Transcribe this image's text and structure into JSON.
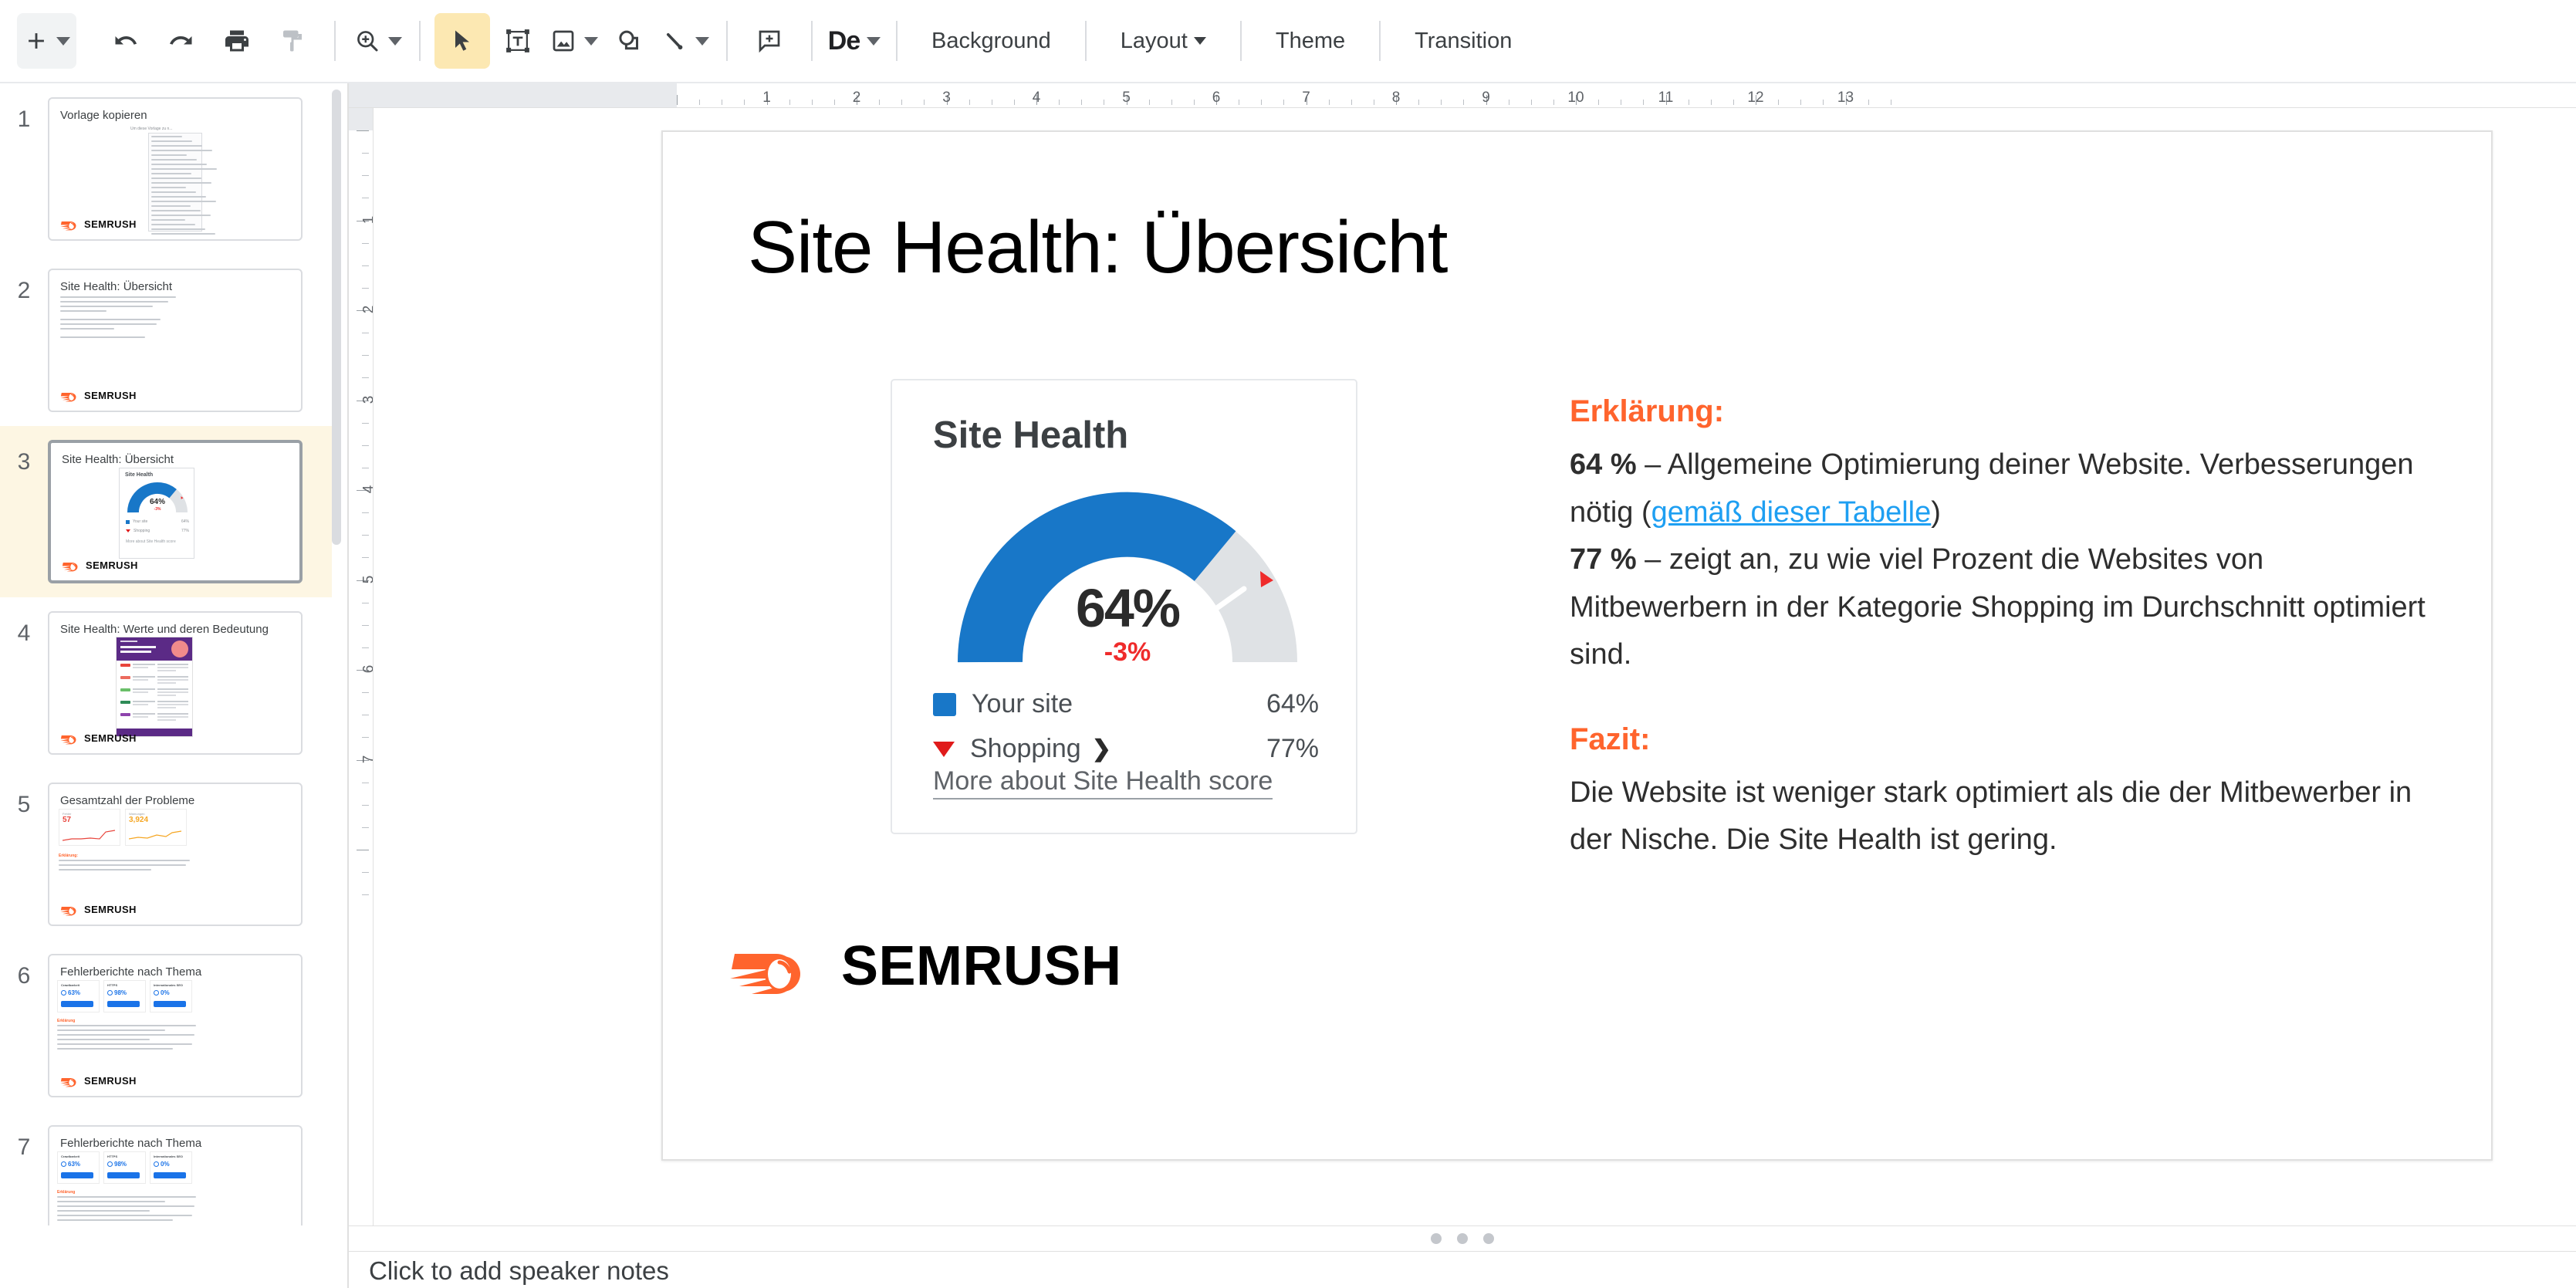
{
  "toolbar": {
    "new_slide_label": "+",
    "buttons": [
      {
        "name": "new-slide",
        "icon": "plus-icon"
      },
      {
        "name": "undo",
        "icon": "undo-arrow-icon"
      },
      {
        "name": "redo",
        "icon": "redo-arrow-icon"
      },
      {
        "name": "print",
        "icon": "printer-icon"
      },
      {
        "name": "paint-format",
        "icon": "paint-roller-icon"
      },
      {
        "name": "zoom",
        "icon": "magnifier-plus-icon"
      },
      {
        "name": "select",
        "icon": "cursor-arrow-icon"
      },
      {
        "name": "text-box",
        "icon": "text-box-icon"
      },
      {
        "name": "insert-image",
        "icon": "image-icon"
      },
      {
        "name": "shape",
        "icon": "shape-icon"
      },
      {
        "name": "line",
        "icon": "line-icon"
      },
      {
        "name": "comment",
        "icon": "comment-plus-icon"
      }
    ],
    "font_label": "De",
    "background_label": "Background",
    "layout_label": "Layout",
    "theme_label": "Theme",
    "transition_label": "Transition"
  },
  "slide_panel": {
    "slides": [
      {
        "number": "1",
        "title": "Vorlage kopieren",
        "logo": "SEMRUSH",
        "selected": false,
        "kind": "doc"
      },
      {
        "number": "2",
        "title": "Site Health: Übersicht",
        "logo": "SEMRUSH",
        "selected": false,
        "kind": "text"
      },
      {
        "number": "3",
        "title": "Site Health: Übersicht",
        "logo": "SEMRUSH",
        "selected": true,
        "kind": "gauge"
      },
      {
        "number": "4",
        "title": "Site Health: Werte und deren Bedeutung",
        "logo": "SEMRUSH",
        "selected": false,
        "kind": "table"
      },
      {
        "number": "5",
        "title": "Gesamtzahl der Probleme",
        "logo": "SEMRUSH",
        "selected": false,
        "kind": "charts"
      },
      {
        "number": "6",
        "title": "Fehlerberichte nach Thema",
        "logo": "SEMRUSH",
        "selected": false,
        "kind": "cards"
      },
      {
        "number": "7",
        "title": "Fehlerberichte nach Thema",
        "logo": "SEMRUSH",
        "selected": false,
        "kind": "cards"
      }
    ]
  },
  "ruler": {
    "horizontal_labels": [
      "1",
      "2",
      "3",
      "4",
      "5",
      "6",
      "7",
      "8",
      "9",
      "10",
      "11",
      "12",
      "13"
    ],
    "vertical_labels": [
      "1",
      "2",
      "3",
      "4",
      "5",
      "6",
      "7"
    ]
  },
  "slide": {
    "title": "Site Health: Übersicht",
    "logo_text": "SEMRUSH",
    "widget": {
      "heading": "Site Health",
      "gauge_value": "64%",
      "gauge_delta": "-3%",
      "legend": [
        {
          "label": "Your site",
          "value": "64%",
          "marker": "square",
          "color": "#1877c8"
        },
        {
          "label": "Shopping",
          "value": "77%",
          "marker": "triangle",
          "color": "#e01b1b",
          "has_chevron": true
        }
      ],
      "link": "More about Site Health score"
    },
    "text": {
      "erklaerung_heading": "Erklärung:",
      "line1_bold": "64 %",
      "line1_rest": " – Allgemeine Optimierung deiner Website. Verbesserungen nötig (",
      "line1_link": "gemäß dieser Tabelle",
      "line1_end": ")",
      "line2_bold": "77 %",
      "line2_rest": " – zeigt an, zu wie viel Prozent die Websites von Mitbewerbern in der Kategorie Shopping im Durchschnitt optimiert sind.",
      "fazit_heading": "Fazit:",
      "fazit_body": "Die Website ist weniger stark optimiert als die der Mitbewerber in der Nische. Die Site Health ist gering."
    }
  },
  "notes": {
    "placeholder": "Click to add speaker notes"
  },
  "colors": {
    "accent_orange": "#ff642d",
    "gauge_blue": "#1877c8",
    "gauge_track": "#dfe2e5",
    "link_blue": "#1e9ff2",
    "red": "#e01b1b",
    "selected_row": "#fdf6e3",
    "toolbar_active": "#fce8b2"
  },
  "chart_data": {
    "type": "pie",
    "title": "Site Health",
    "subtitle": "Gauge / donut — 180° semicircular",
    "categories": [
      "Your site",
      "Shopping"
    ],
    "values": [
      64,
      77
    ],
    "units": "%",
    "series": [
      {
        "name": "Your site",
        "values": [
          64
        ],
        "color": "#1877c8",
        "rendered_as": "filled-arc"
      },
      {
        "name": "Shopping (benchmark)",
        "values": [
          77
        ],
        "color": "#e01b1b",
        "rendered_as": "red-marker-tick"
      }
    ],
    "center_label": "64%",
    "delta_label": "-3%",
    "delta_value": -3,
    "track_color": "#dfe2e5",
    "axis_range": [
      0,
      100
    ],
    "legend_position": "bottom",
    "grid": false,
    "annotations": [
      "More about Site Health score"
    ]
  }
}
